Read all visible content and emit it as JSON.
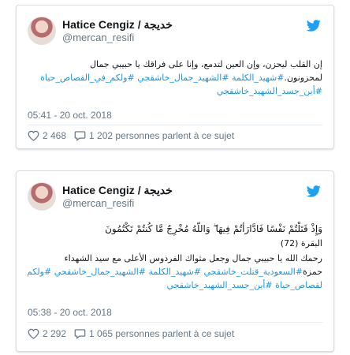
{
  "colors": {
    "link": "#1b95e0",
    "twitter_blue": "#1da1f2",
    "muted": "#657786"
  },
  "tweets": [
    {
      "author_name": "Hatice Cengiz / خديجة",
      "author_handle": "@mercan_resifi",
      "text_lines": [
        "إن القلب ليحزن، وإن العين لتدمع، وإنا على فراقك يا حبيبي جمال",
        "لمحزونون.",
        "#أين_جسد_الشهيد_خاشقجي"
      ],
      "hashtags_line2": "#شهيد_الكلمة #الشهيد_جمال_خاشقجي #ولكم_في_القصاص_حياة",
      "timestamp": "05:41 - 20 oct. 2018",
      "likes": "2 468",
      "talking": "1 202 personnes parlent à ce sujet"
    },
    {
      "author_name": "Hatice Cengiz / خديجة",
      "author_handle": "@mercan_resifi",
      "quran_line": "وَإِذْ قَتَلْتُمْ نَفْسًا فَادَّارَأْتُمْ فِيهَا ۖ وَاللَّهُ مُخْرِجٌ مَّا كُنتُمْ تَكْتُمُونَ",
      "quran_ref": "البقرة (72)",
      "text_line": "رحمك الله يا حبيبي جمال وجعل مثواك الفردوس الأعلى مع سيد الشهداء",
      "hashtag_line1_plain": "حمزة",
      "hashtag_line1_tags": "#السعودية_قتلت_خاشقجي #شهيد_الكلمة #الشهيد_جمال_خاشقجي #ولكم_في_ا",
      "hashtag_line2_tags": "لقصاص_حياة #أين_جسد_الشهيد_خاشقجي",
      "timestamp": "05:38 - 20 oct. 2018",
      "likes": "2 292",
      "talking": "1 065 personnes parlent à ce sujet"
    }
  ]
}
